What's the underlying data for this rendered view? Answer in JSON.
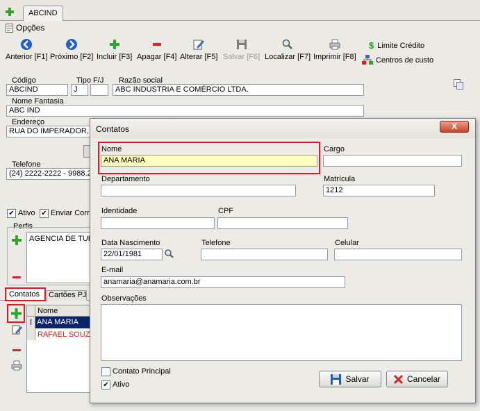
{
  "top": {
    "tab_label": "ABCIND",
    "options_label": "Opções"
  },
  "toolbar": {
    "anterior": "Anterior [F1]",
    "proximo": "Próximo [F2]",
    "incluir": "Incluir [F3]",
    "apagar": "Apagar [F4]",
    "alterar": "Alterar [F5]",
    "salvar": "Salvar [F6]",
    "localizar": "Localizar [F7]",
    "imprimir": "Imprimir [F8]",
    "limite_credito": "Limite Crédito",
    "centros_custo": "Centros de custo"
  },
  "form": {
    "codigo_label": "Código",
    "codigo_value": "ABCIND",
    "tipo_label": "Tipo F/J",
    "tipo_value": "J",
    "razao_label": "Razão social",
    "razao_value": "ABC INDÚSTRIA E COMÉRCIO LTDA.",
    "fantasia_label": "Nome Fantasia",
    "fantasia_value": "ABC IND",
    "endereco_label": "Endereço",
    "endereco_value": "RUA DO IMPERADOR,",
    "telefone_label": "Telefone",
    "telefone_value": "(24) 2222-2222 -   9988.2",
    "ativo_label": "Ativo",
    "enviar_label": "Enviar Corre",
    "perfis_label": "Perfis",
    "perfil_item": "AGENCIA DE TUF"
  },
  "bottom_tabs": {
    "contatos": "Contatos",
    "cartoes": "Cartões PJ"
  },
  "contacts_grid": {
    "header_nome": "Nome",
    "rows": [
      "ANA MARIA",
      "RAFAEL SOUZ"
    ]
  },
  "dialog": {
    "title": "Contatos",
    "close": "X",
    "nome_label": "Nome",
    "nome_value": "ANA MARIA",
    "cargo_label": "Cargo",
    "cargo_value": "",
    "departamento_label": "Departamento",
    "departamento_value": "",
    "matricula_label": "Matrícula",
    "matricula_value": "1212",
    "identidade_label": "Identidade",
    "identidade_value": "",
    "cpf_label": "CPF",
    "cpf_value": "",
    "nascimento_label": "Data Nascimento",
    "nascimento_value": "22/01/1981",
    "telefone_label": "Telefone",
    "telefone_value": "",
    "celular_label": "Celular",
    "celular_value": "",
    "email_label": "E-mail",
    "email_value": "anamaria@anamaria.com.br",
    "obs_label": "Observações",
    "obs_value": "",
    "principal_label": "Contato Principal",
    "ativo_label": "Ativo",
    "salvar_label": "Salvar",
    "cancelar_label": "Cancelar"
  },
  "colors": {
    "highlight_red": "#e0191f",
    "field_highlight": "#ffffc0",
    "selected_row": "#0a246a",
    "red_text": "#cc1f1f"
  }
}
